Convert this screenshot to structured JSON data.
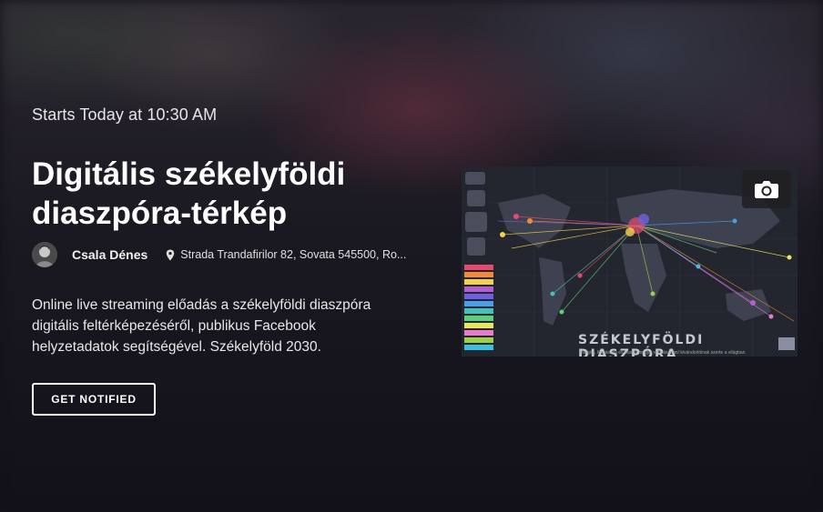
{
  "event": {
    "starts": "Starts Today at 10:30 AM",
    "title": "Digitális székelyföldi diaszpóra-térkép",
    "host": {
      "name": "Csala Dénes",
      "avatar_icon": "person-avatar"
    },
    "location": "Strada Trandafirilor 82, Sovata 545500, Ro...",
    "location_icon": "map-pin-icon",
    "description": "Online live streaming előadás a székelyföldi diaszpóra digitális feltérképezéséről, publikus Facebook helyzetadatok segítségével. Székelyföld 2030.",
    "notify_label": "GET NOTIFIED"
  },
  "thumbnail": {
    "title": "SZÉKELYFÖLDI DIASZPÓRA",
    "subtitle": "Hargita, Kovászna és Maros megye vonzásában/ kivándorlóinak szerte a világban",
    "camera_icon": "camera-icon",
    "legend_colors": [
      "#e84a6f",
      "#f08a3c",
      "#f2d14b",
      "#b35fd1",
      "#6f5fe0",
      "#4aa0e8",
      "#44c2b8",
      "#5cd07a",
      "#e8e85a",
      "#e87ad0",
      "#9bd24a",
      "#3cc0e0"
    ]
  },
  "colors": {
    "accent": "#ffffff",
    "text_muted": "#e6e6e6"
  }
}
